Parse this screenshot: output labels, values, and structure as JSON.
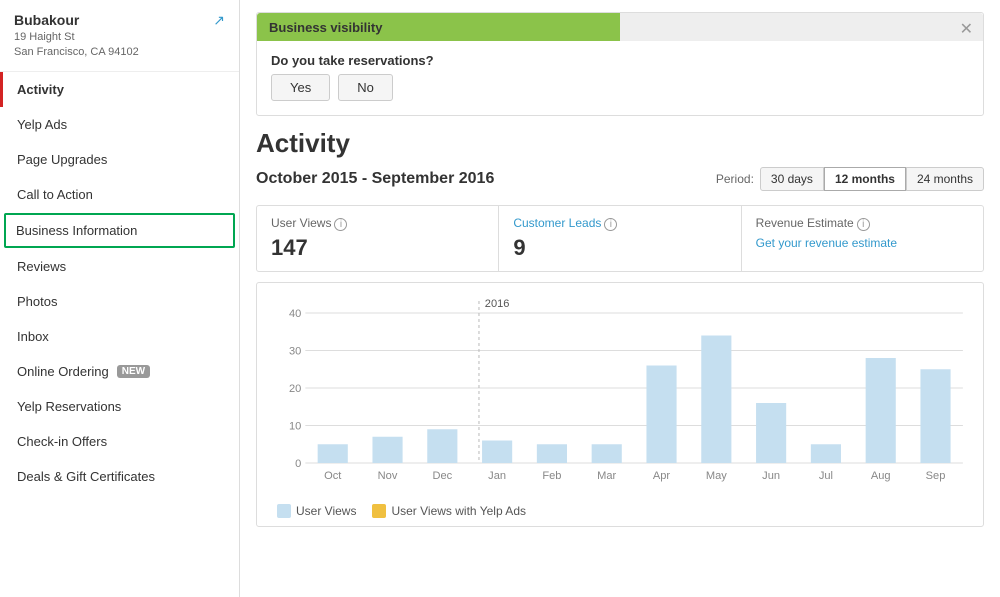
{
  "sidebar": {
    "business": {
      "name": "Bubakour",
      "address_line1": "19 Haight St",
      "address_line2": "San Francisco, CA 94102"
    },
    "items": [
      {
        "id": "activity",
        "label": "Activity",
        "active": true
      },
      {
        "id": "yelp-ads",
        "label": "Yelp Ads",
        "active": false
      },
      {
        "id": "page-upgrades",
        "label": "Page Upgrades",
        "active": false
      },
      {
        "id": "call-to-action",
        "label": "Call to Action",
        "active": false
      },
      {
        "id": "business-information",
        "label": "Business Information",
        "active": false,
        "selected": true
      },
      {
        "id": "reviews",
        "label": "Reviews",
        "active": false
      },
      {
        "id": "photos",
        "label": "Photos",
        "active": false
      },
      {
        "id": "inbox",
        "label": "Inbox",
        "active": false
      },
      {
        "id": "online-ordering",
        "label": "Online Ordering",
        "active": false,
        "badge": "NEW"
      },
      {
        "id": "yelp-reservations",
        "label": "Yelp Reservations",
        "active": false
      },
      {
        "id": "check-in-offers",
        "label": "Check-in Offers",
        "active": false
      },
      {
        "id": "deals-gift-certificates",
        "label": "Deals & Gift Certificates",
        "active": false
      }
    ]
  },
  "banner": {
    "progress_label": "Business visibility",
    "question": "Do you take reservations?",
    "yes_label": "Yes",
    "no_label": "No"
  },
  "activity": {
    "title": "Activity",
    "period_range": "October 2015 - September 2016",
    "period_label": "Period:",
    "periods": [
      {
        "label": "30 days",
        "active": false
      },
      {
        "label": "12 months",
        "active": true
      },
      {
        "label": "24 months",
        "active": false
      }
    ],
    "stats": [
      {
        "label": "User Views",
        "info": true,
        "value": "147",
        "is_link": false
      },
      {
        "label": "Customer Leads",
        "info": true,
        "value": "9",
        "is_link": true
      },
      {
        "label": "Revenue Estimate",
        "info": true,
        "value": null,
        "link_text": "Get your revenue estimate",
        "is_link": true
      }
    ],
    "chart": {
      "year_label": "2016",
      "months": [
        "Oct",
        "Nov",
        "Dec",
        "Jan",
        "Feb",
        "Mar",
        "Apr",
        "May",
        "Jun",
        "Jul",
        "Aug",
        "Sep"
      ],
      "values": [
        5,
        7,
        9,
        6,
        5,
        5,
        26,
        34,
        16,
        5,
        28,
        25
      ],
      "y_max": 40,
      "y_ticks": [
        0,
        10,
        20,
        30,
        40
      ]
    },
    "legend": [
      {
        "label": "User Views",
        "color": "#c5dff0"
      },
      {
        "label": "User Views with Yelp Ads",
        "color": "#f0c040"
      }
    ]
  }
}
